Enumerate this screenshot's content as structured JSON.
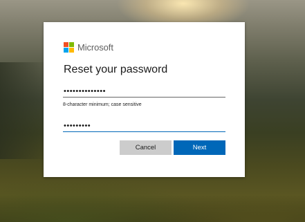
{
  "brand": {
    "name": "Microsoft",
    "logo_colors": [
      "#f25022",
      "#7fba00",
      "#00a4ef",
      "#ffb900"
    ]
  },
  "dialog": {
    "title": "Reset your password",
    "new_password": {
      "value": "••••••••••••••"
    },
    "hint": "8-character minimum; case sensitive",
    "confirm_password": {
      "value": "•••••••••"
    },
    "cancel_label": "Cancel",
    "next_label": "Next"
  },
  "colors": {
    "primary": "#0067b8",
    "secondary_button": "#cccccc"
  }
}
